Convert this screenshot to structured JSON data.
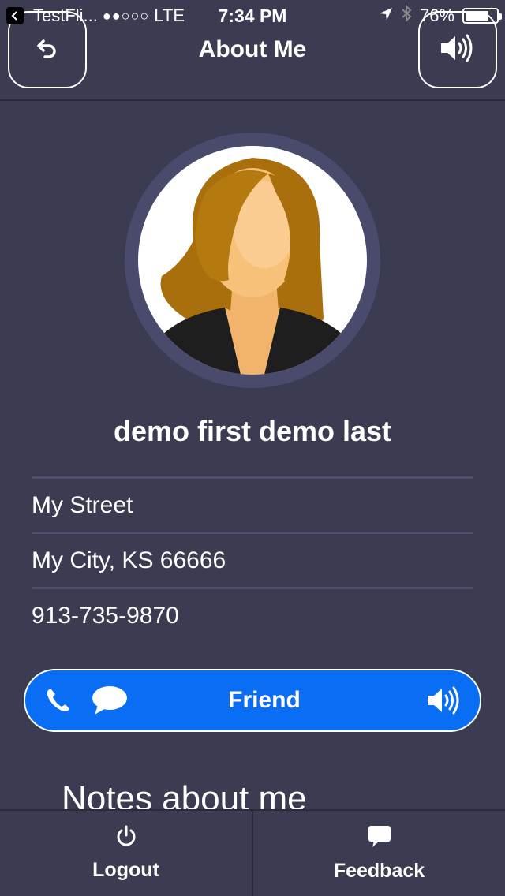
{
  "status_bar": {
    "carrier": "TestFli...",
    "signal": "●●○○○",
    "network": "LTE",
    "time": "7:34 PM",
    "battery_percent": "76%",
    "battery_level": 0.76
  },
  "header": {
    "title": "About Me",
    "back_icon": "undo-arrow-icon",
    "sound_icon": "speaker-icon"
  },
  "profile": {
    "name": "demo first demo last",
    "street": "My Street",
    "city": "My City, KS 66666",
    "phone": "913-735-9870"
  },
  "friend_bar": {
    "label": "Friend",
    "icons": [
      "phone-icon",
      "chat-bubble-icon",
      "speaker-icon"
    ],
    "color": "#0a6ef5"
  },
  "notes": {
    "heading": "Notes about me"
  },
  "bottom_bar": {
    "logout_label": "Logout",
    "feedback_label": "Feedback"
  },
  "colors": {
    "background": "#3b3b52",
    "avatar_ring": "#4a4a6c",
    "accent": "#0a6ef5"
  }
}
